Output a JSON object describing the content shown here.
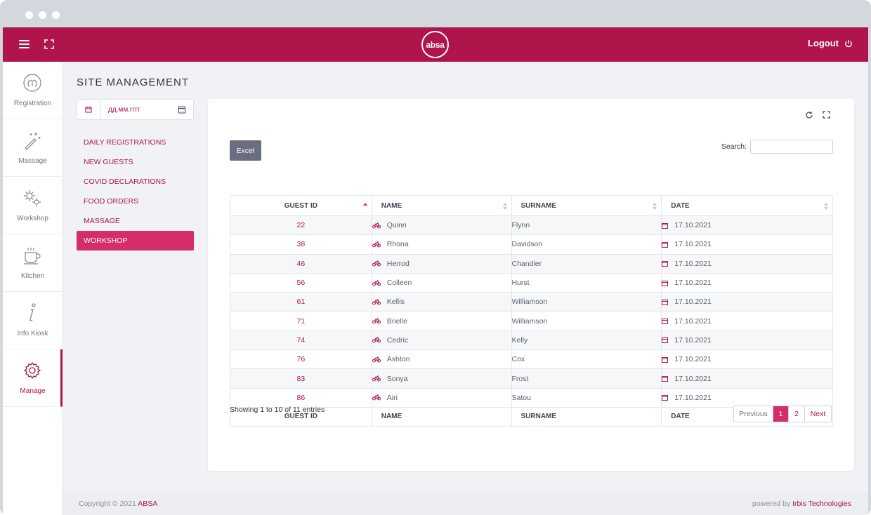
{
  "header": {
    "logo_text": "absa",
    "logout_label": "Logout"
  },
  "sidenav": [
    {
      "label": "Registration",
      "icon": "registration-icon"
    },
    {
      "label": "Massage",
      "icon": "magic-wand-icon"
    },
    {
      "label": "Workshop",
      "icon": "gears-icon"
    },
    {
      "label": "Kitchen",
      "icon": "coffee-cup-icon"
    },
    {
      "label": "Info Kiosk",
      "icon": "info-icon"
    },
    {
      "label": "Manage",
      "icon": "gear-icon",
      "active": true
    }
  ],
  "page": {
    "title": "SITE MANAGEMENT",
    "date_placeholder": "дд.мм.гггг"
  },
  "submenu": [
    "DAILY REGISTRATIONS",
    "NEW GUESTS",
    "COVID DECLARATIONS",
    "FOOD ORDERS",
    "MASSAGE",
    "WORKSHOP"
  ],
  "submenu_active": "WORKSHOP",
  "toolbar": {
    "excel_label": "Excel",
    "search_label": "Search:",
    "search_value": ""
  },
  "table": {
    "columns": [
      "GUEST ID",
      "NAME",
      "SURNAME",
      "DATE"
    ],
    "rows": [
      {
        "id": "22",
        "name": "Quinn",
        "surname": "Flynn",
        "date": "17.10.2021"
      },
      {
        "id": "38",
        "name": "Rhona",
        "surname": "Davidson",
        "date": "17.10.2021"
      },
      {
        "id": "46",
        "name": "Herrod",
        "surname": "Chandler",
        "date": "17.10.2021"
      },
      {
        "id": "56",
        "name": "Colleen",
        "surname": "Hurst",
        "date": "17.10.2021"
      },
      {
        "id": "61",
        "name": "Kellis",
        "surname": "Williamson",
        "date": "17.10.2021"
      },
      {
        "id": "71",
        "name": "Brielle",
        "surname": "Williamson",
        "date": "17.10.2021"
      },
      {
        "id": "74",
        "name": "Cedric",
        "surname": "Kelly",
        "date": "17.10.2021"
      },
      {
        "id": "76",
        "name": "Ashton",
        "surname": "Cox",
        "date": "17.10.2021"
      },
      {
        "id": "83",
        "name": "Sonya",
        "surname": "Frost",
        "date": "17.10.2021"
      },
      {
        "id": "86",
        "name": "Airi",
        "surname": "Satou",
        "date": "17.10.2021"
      }
    ],
    "info": "Showing 1 to 10 of 11 entries"
  },
  "pagination": {
    "previous": "Previous",
    "pages": [
      "1",
      "2"
    ],
    "current": "1",
    "next": "Next"
  },
  "footer": {
    "copyright_prefix": "Copyright © 2021 ",
    "copyright_brand": "ABSA",
    "powered_prefix": "powered by ",
    "powered_brand": "Irbis Technologies"
  },
  "colors": {
    "brand": "#af144b",
    "brand_light": "#d42d69",
    "excel_button": "#6b6e80"
  }
}
